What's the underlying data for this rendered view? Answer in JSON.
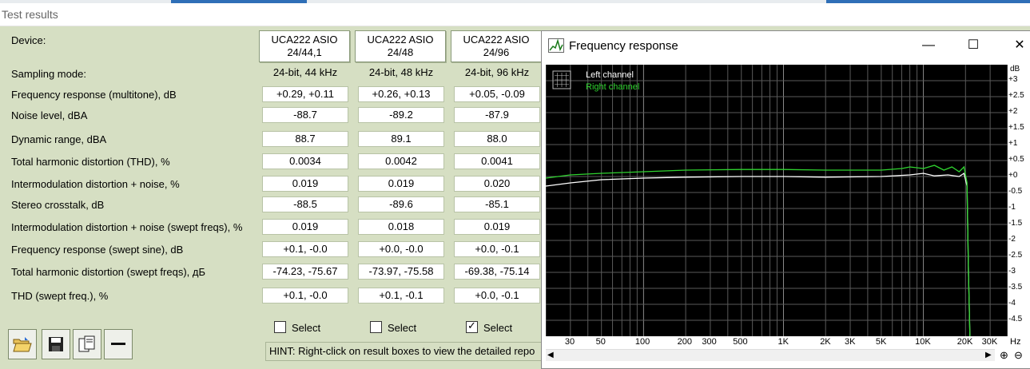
{
  "window": {
    "title": "Test results"
  },
  "labels": [
    "Device:",
    "Sampling mode:",
    "Frequency response (multitone), dB",
    "Noise level, dBA",
    "Dynamic range, dBA",
    "Total harmonic distortion (THD), %",
    "Intermodulation distortion + noise, %",
    "Stereo crosstalk, dB",
    "Intermodulation distortion + noise (swept freqs), %",
    "Frequency response (swept sine), dB",
    "Total harmonic distortion (swept freqs), дБ",
    "THD (swept freq.), %"
  ],
  "devices": [
    {
      "name_line1": "UCA222 ASIO",
      "name_line2": "24/44,1",
      "sampling": "24-bit, 44 kHz",
      "values": [
        "+0.29, +0.11",
        "-88.7",
        "88.7",
        "0.0034",
        "0.019",
        "-88.5",
        "0.019",
        "+0.1, -0.0",
        "-74.23, -75.67",
        "+0.1, -0.0"
      ],
      "select_label": "Select",
      "selected": false
    },
    {
      "name_line1": "UCA222 ASIO",
      "name_line2": "24/48",
      "sampling": "24-bit, 48 kHz",
      "values": [
        "+0.26, +0.13",
        "-89.2",
        "89.1",
        "0.0042",
        "0.019",
        "-89.6",
        "0.018",
        "+0.0, -0.0",
        "-73.97, -75.58",
        "+0.1, -0.1"
      ],
      "select_label": "Select",
      "selected": false
    },
    {
      "name_line1": "UCA222 ASIO",
      "name_line2": "24/96",
      "sampling": "24-bit, 96 kHz",
      "values": [
        "+0.05, -0.09",
        "-87.9",
        "88.0",
        "0.0041",
        "0.020",
        "-85.1",
        "0.019",
        "+0.0, -0.1",
        "-69.38, -75.14",
        "+0.0, -0.1"
      ],
      "select_label": "Select",
      "selected": true
    }
  ],
  "hint": "HINT: Right-click on result boxes to view the detailed repo",
  "toolbar": [
    "open-folder-icon",
    "save-icon",
    "copy-icon",
    "minus-icon"
  ],
  "freq_window": {
    "title": "Frequency response",
    "buttons": {
      "minimize": "—",
      "maximize": "☐",
      "close": "✕"
    },
    "legend": {
      "left": "Left channel",
      "right": "Right channel"
    },
    "y_unit": "dB",
    "x_unit": "Hz",
    "y_ticks": [
      "+3",
      "+2.5",
      "+2",
      "+1.5",
      "+1",
      "+0.5",
      "+0",
      "-0.5",
      "-1",
      "-1.5",
      "-2",
      "-2.5",
      "-3",
      "-3.5",
      "-4",
      "-4.5"
    ],
    "x_ticks": [
      "30",
      "50",
      "100",
      "200",
      "300",
      "500",
      "1K",
      "2K",
      "3K",
      "5K",
      "10K",
      "20K",
      "30K"
    ],
    "colors": {
      "left": "#ffffff",
      "right": "#2fd42f",
      "background": "#000000"
    }
  },
  "chart_data": {
    "type": "line",
    "ylabel": "dB",
    "xlabel": "Hz",
    "x_scale": "log",
    "xlim": [
      20,
      40000
    ],
    "ylim": [
      -5,
      3.5
    ],
    "series": [
      {
        "name": "Left channel",
        "x": [
          20,
          30,
          50,
          100,
          200,
          500,
          1000,
          2000,
          5000,
          8000,
          10000,
          12000,
          15000,
          18000,
          19500,
          20500,
          21000,
          21500
        ],
        "y": [
          -0.3,
          -0.2,
          -0.1,
          -0.05,
          -0.02,
          0.0,
          0.0,
          -0.02,
          0.0,
          0.05,
          0.1,
          0.02,
          0.05,
          0.0,
          0.1,
          -0.3,
          -3.0,
          -5.0
        ]
      },
      {
        "name": "Right channel",
        "x": [
          20,
          30,
          50,
          100,
          200,
          500,
          1000,
          2000,
          5000,
          7000,
          8000,
          10000,
          12000,
          14000,
          16000,
          18000,
          19500,
          20500,
          21000,
          21500
        ],
        "y": [
          -0.05,
          0.05,
          0.1,
          0.15,
          0.2,
          0.22,
          0.22,
          0.2,
          0.2,
          0.25,
          0.3,
          0.25,
          0.35,
          0.2,
          0.3,
          0.15,
          0.3,
          -0.2,
          -3.0,
          -5.0
        ]
      }
    ]
  }
}
